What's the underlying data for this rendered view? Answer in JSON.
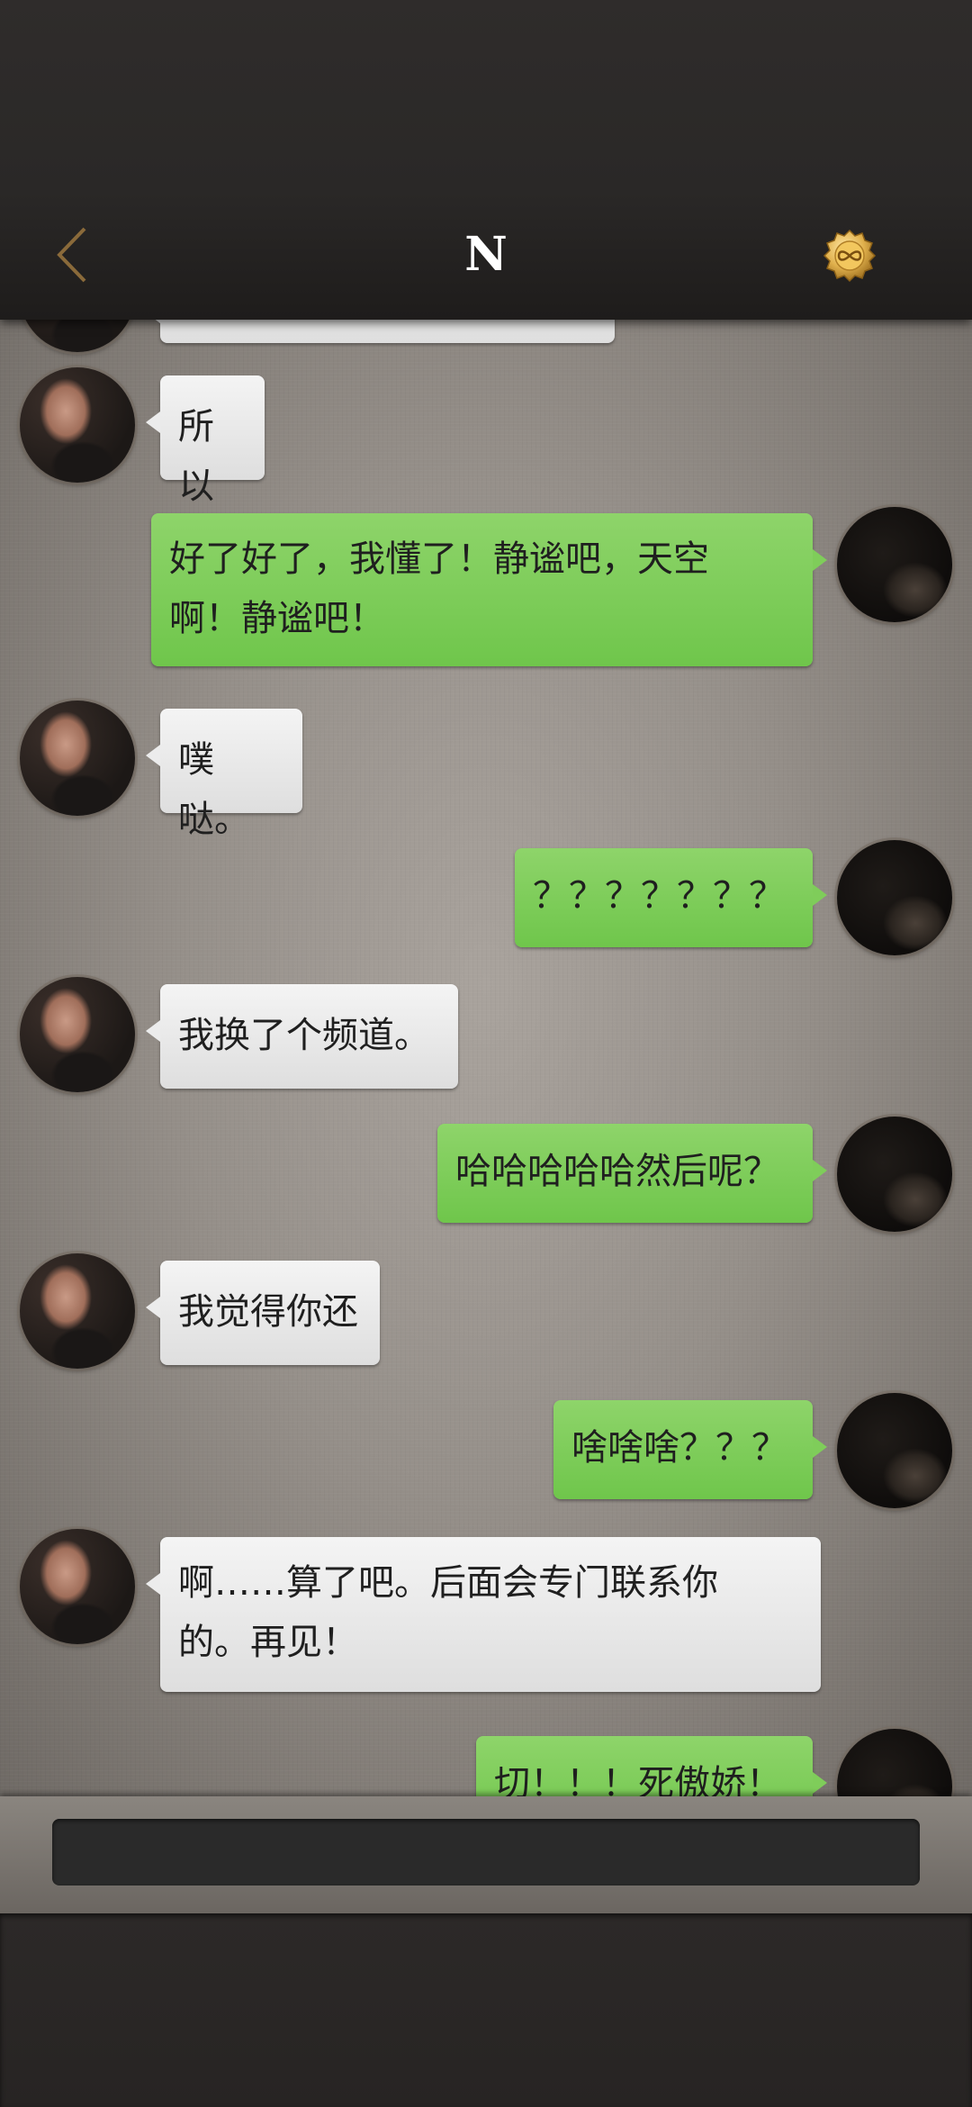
{
  "header": {
    "title": "N",
    "accent_color": "#8a6a3a",
    "coin_icon": "infinity-coin-icon"
  },
  "messages": [
    {
      "from": "other",
      "text": ""
    },
    {
      "from": "other",
      "text": "所以"
    },
    {
      "from": "self",
      "text": "好了好了，我懂了！静谧吧，天空\n啊！静谧吧！"
    },
    {
      "from": "other",
      "text": "噗哒。"
    },
    {
      "from": "self",
      "text": "？？？？？？？"
    },
    {
      "from": "other",
      "text": "我换了个频道。"
    },
    {
      "from": "self",
      "text": "哈哈哈哈哈然后呢？"
    },
    {
      "from": "other",
      "text": "我觉得你还"
    },
    {
      "from": "self",
      "text": "啥啥啥？？？"
    },
    {
      "from": "other",
      "text": "啊……算了吧。后面会专门联系你\n的。再见！"
    },
    {
      "from": "self",
      "text": "切！！！死傲娇！"
    }
  ],
  "input": {
    "value": "",
    "placeholder": ""
  },
  "colors": {
    "sent_bubble": "#7fcd5a",
    "received_bubble": "#ececec",
    "chat_background": "#958f89"
  }
}
